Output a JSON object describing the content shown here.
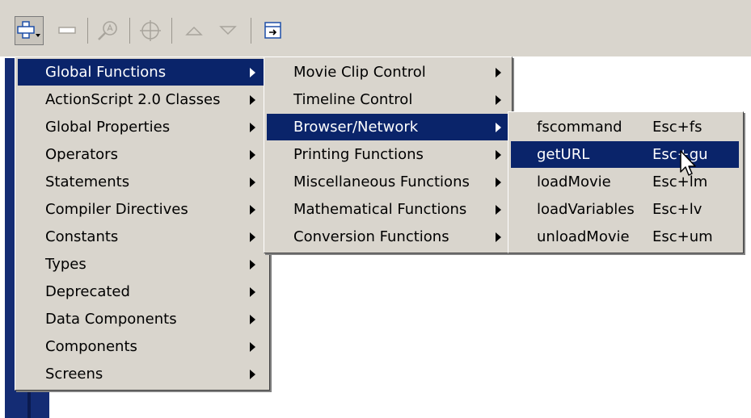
{
  "menu1": {
    "items": [
      {
        "label": "Global Functions",
        "active": true
      },
      {
        "label": "ActionScript 2.0 Classes"
      },
      {
        "label": "Global Properties"
      },
      {
        "label": "Operators"
      },
      {
        "label": "Statements"
      },
      {
        "label": "Compiler Directives"
      },
      {
        "label": "Constants"
      },
      {
        "label": "Types"
      },
      {
        "label": "Deprecated"
      },
      {
        "label": "Data Components"
      },
      {
        "label": "Components"
      },
      {
        "label": "Screens"
      }
    ]
  },
  "menu2": {
    "items": [
      {
        "label": "Movie Clip Control"
      },
      {
        "label": "Timeline Control"
      },
      {
        "label": "Browser/Network",
        "active": true
      },
      {
        "label": "Printing Functions"
      },
      {
        "label": "Miscellaneous Functions"
      },
      {
        "label": "Mathematical Functions"
      },
      {
        "label": "Conversion Functions"
      }
    ]
  },
  "menu3": {
    "items": [
      {
        "label": "fscommand",
        "shortcut": "Esc+fs"
      },
      {
        "label": "getURL",
        "shortcut": "Esc+gu",
        "active": true
      },
      {
        "label": "loadMovie",
        "shortcut": "Esc+lm"
      },
      {
        "label": "loadVariables",
        "shortcut": "Esc+lv"
      },
      {
        "label": "unloadMovie",
        "shortcut": "Esc+um"
      }
    ]
  },
  "toolbar": {
    "icons": [
      "add-statement-icon",
      "remove-statement-icon",
      "find-icon",
      "insert-target-path-icon",
      "move-up-icon",
      "move-down-icon",
      "script-assist-icon"
    ]
  },
  "colors": {
    "menu_bg": "#d9d5cd",
    "highlight": "#0a246a",
    "editor": "#142c74"
  }
}
